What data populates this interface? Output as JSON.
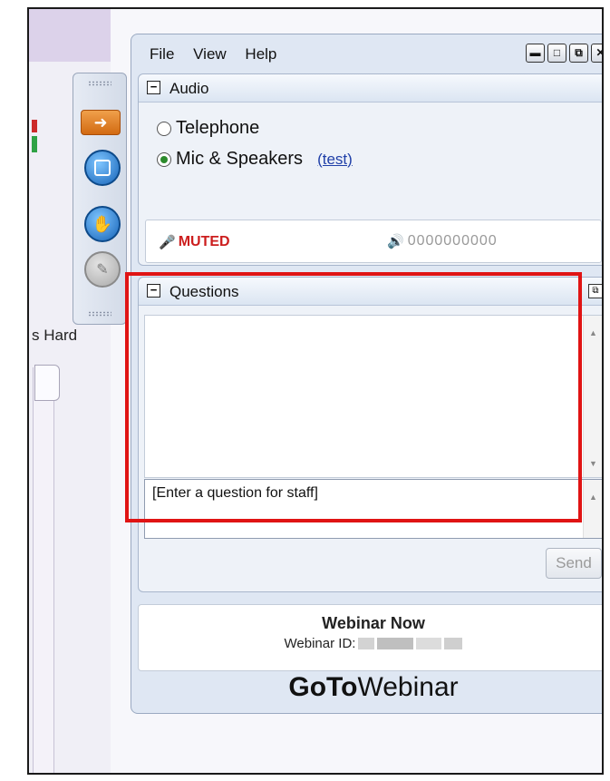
{
  "background": {
    "partial_text": "s Hard"
  },
  "menu": [
    "File",
    "View",
    "Help"
  ],
  "window_controls": [
    "minimize",
    "restore",
    "popout",
    "close"
  ],
  "audio": {
    "title": "Audio",
    "options": [
      {
        "label": "Telephone",
        "selected": false
      },
      {
        "label": "Mic & Speakers",
        "selected": true
      }
    ],
    "test_link": "(test)",
    "mic_status": "MUTED",
    "volume_indicator": "0000000000"
  },
  "questions": {
    "title": "Questions",
    "placeholder": "[Enter a question for staff]",
    "send_label": "Send"
  },
  "webinar": {
    "name": "Webinar Now",
    "id_label": "Webinar ID:",
    "brand_bold": "GoTo",
    "brand_light": "Webinar"
  },
  "colors": {
    "muted": "#cc1e1e",
    "highlight": "#e01414",
    "link": "#1f3fa8"
  }
}
